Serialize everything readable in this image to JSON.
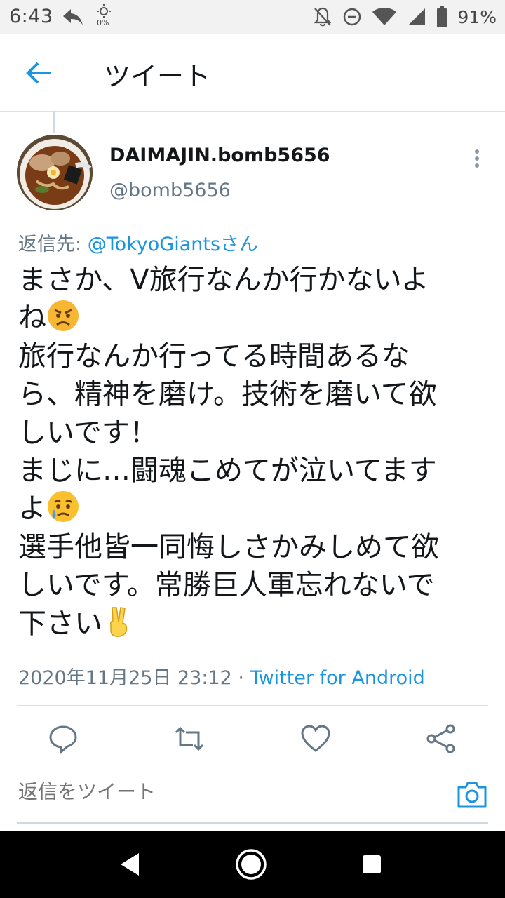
{
  "status_bar": {
    "time": "6:43",
    "brightness_pct": "0%",
    "battery": "91%",
    "icons": [
      "reply-arrow-icon",
      "brightness-icon",
      "silent-icon",
      "do-not-disturb-icon",
      "wifi-icon",
      "signal-icon",
      "battery-icon"
    ]
  },
  "app_bar": {
    "title": "ツイート",
    "back_icon": "arrow-left-icon"
  },
  "tweet": {
    "display_name": "DAIMAJIN.bomb5656",
    "handle": "@bomb5656",
    "reply_prefix": "返信先: ",
    "reply_mention": "@TokyoGiantsさん",
    "text_lines": [
      "まさか、V旅行なんか行かないよ",
      "ね",
      "旅行なんか行ってる時間あるな",
      "ら、精神を磨け。技術を磨いて欲",
      "しいです！",
      "まじに…闘魂こめてが泣いてます",
      "よ",
      "選手他皆一同悔しさかみしめて欲",
      "しいです。常勝巨人軍忘れないで",
      "下さい"
    ],
    "emojis": [
      "angry-face-emoji",
      "sad-relieved-face-emoji",
      "victory-hand-emoji"
    ],
    "timestamp": "2020年11月25日 23:12 · ",
    "source": "Twitter for Android"
  },
  "actions": [
    "reply-icon",
    "retweet-icon",
    "like-icon",
    "share-icon"
  ],
  "compose": {
    "placeholder": "返信をツイート"
  },
  "colors": {
    "accent": "#1b95e0",
    "secondary_text": "#657786",
    "divider": "#dcdfe3"
  }
}
